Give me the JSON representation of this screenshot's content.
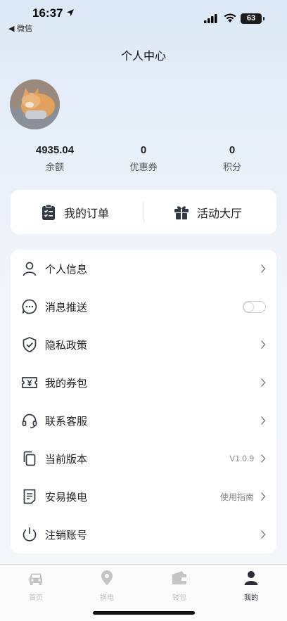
{
  "status_bar": {
    "time": "16:37",
    "back_app": "◀ 微信",
    "battery": "63"
  },
  "header": {
    "title": "个人中心"
  },
  "stats": [
    {
      "value": "4935.04",
      "label": "余额"
    },
    {
      "value": "0",
      "label": "优惠券"
    },
    {
      "value": "0",
      "label": "积分"
    }
  ],
  "quick": {
    "orders": "我的订单",
    "activities": "活动大厅"
  },
  "menu": [
    {
      "label": "个人信息",
      "icon": "user-icon"
    },
    {
      "label": "消息推送",
      "icon": "chat-bubble-icon",
      "toggle_on": false
    },
    {
      "label": "隐私政策",
      "icon": "shield-check-icon"
    },
    {
      "label": "我的券包",
      "icon": "coupon-icon"
    },
    {
      "label": "联系客服",
      "icon": "headset-icon"
    },
    {
      "label": "当前版本",
      "icon": "copy-icon",
      "extra": "V1.0.9"
    },
    {
      "label": "安易换电",
      "icon": "document-icon",
      "extra": "使用指南"
    },
    {
      "label": "注销账号",
      "icon": "power-icon"
    }
  ],
  "tabbar": [
    {
      "label": "首页",
      "icon": "car-icon",
      "active": false
    },
    {
      "label": "换电",
      "icon": "map-pin-icon",
      "active": false
    },
    {
      "label": "钱包",
      "icon": "wallet-icon",
      "active": false
    },
    {
      "label": "我的",
      "icon": "person-icon",
      "active": true
    }
  ],
  "colors": {
    "accent": "#2a2f3a",
    "inactive": "#bdbdbd",
    "icon": "#333a45"
  }
}
